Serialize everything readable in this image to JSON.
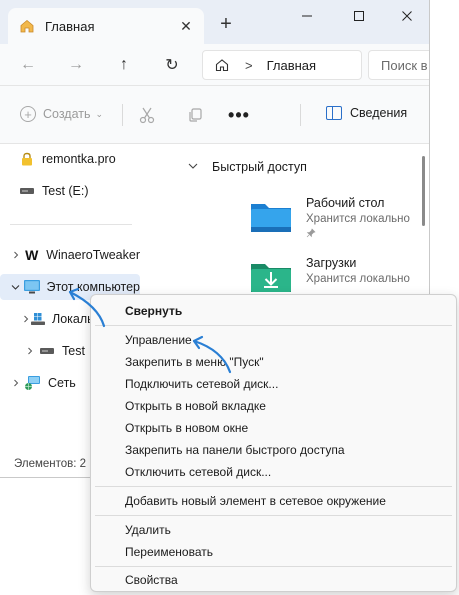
{
  "window": {
    "tab_title": "Главная",
    "tab_close_glyph": "✕",
    "new_tab_glyph": "+",
    "minimize_glyph": "—",
    "close_glyph": "✕"
  },
  "navbar": {
    "back_glyph": "←",
    "forward_glyph": "→",
    "up_glyph": "↑",
    "refresh_glyph": "↻",
    "separator_glyph": ">",
    "breadcrumb": "Главная",
    "search_placeholder": "Поиск в"
  },
  "commandbar": {
    "create_label": "Создать",
    "create_chevron": "⌄",
    "more_label": "•••",
    "details_label": "Сведения"
  },
  "navpane": {
    "items": [
      {
        "label": "remontka.pro",
        "icon": "lock-icon",
        "expander": ""
      },
      {
        "label": "Test (E:)",
        "icon": "drive-icon",
        "expander": ""
      },
      {
        "label": "WinaeroTweaker",
        "icon": "winaero-icon",
        "expander": ">"
      },
      {
        "label": "Этот компьютер",
        "icon": "computer-icon",
        "expander": "v"
      },
      {
        "label": "Локальный диск",
        "icon": "windows-drive-icon",
        "expander": ">"
      },
      {
        "label": "Test",
        "icon": "drive-icon",
        "expander": ">"
      },
      {
        "label": "Сеть",
        "icon": "network-icon",
        "expander": ">"
      }
    ],
    "status": "Элементов: 2"
  },
  "content": {
    "section_title": "Быстрый доступ",
    "section_chevron": "v",
    "items": [
      {
        "title": "Рабочий стол",
        "subtitle": "Хранится локально",
        "icon": "desktop-folder-icon"
      },
      {
        "title": "Загрузки",
        "subtitle": "Хранится локально",
        "icon": "downloads-folder-icon"
      }
    ]
  },
  "context_menu": {
    "groups": [
      [
        "Свернуть"
      ],
      [
        "Управление",
        "Закрепить в меню \"Пуск\"",
        "Подключить сетевой диск...",
        "Открыть в новой вкладке",
        "Открыть в новом окне",
        "Закрепить на панели быстрого доступа",
        "Отключить сетевой диск..."
      ],
      [
        "Добавить новый элемент в сетевое окружение"
      ],
      [
        "Удалить",
        "Переименовать"
      ],
      [
        "Свойства"
      ]
    ]
  },
  "colors": {
    "accent": "#2a6fc9",
    "annotation_arrow": "#2a7fd4",
    "titlebar_bg": "#e9eef6",
    "selected_bg": "#e3ecf9"
  }
}
